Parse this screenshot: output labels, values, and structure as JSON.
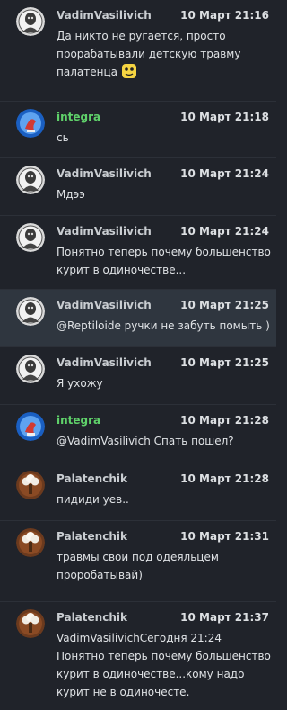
{
  "messages": [
    {
      "author": "VadimVasilivich",
      "avatar": "vadim-avatar",
      "time": "10 Март 21:16",
      "text": "Да никто не ругается, просто прорабатывали детскую травму палатенца",
      "emoji": "emoji-sticker"
    },
    {
      "author": "integra",
      "avatar": "integra-avatar",
      "time": "10 Март 21:18",
      "text": "сь"
    },
    {
      "author": "VadimVasilivich",
      "avatar": "vadim-avatar",
      "time": "10 Март 21:24",
      "text": "Мдээ"
    },
    {
      "author": "VadimVasilivich",
      "avatar": "vadim-avatar",
      "time": "10 Март 21:24",
      "text": "Понятно теперь почему большенство курит в одиночестве..."
    },
    {
      "author": "VadimVasilivich",
      "avatar": "vadim-avatar",
      "time": "10 Март 21:25",
      "text": "@Reptiloide ручки не забуть помыть )"
    },
    {
      "author": "VadimVasilivich",
      "avatar": "vadim-avatar",
      "time": "10 Март 21:25",
      "text": "Я ухожу"
    },
    {
      "author": "integra",
      "avatar": "integra-avatar",
      "time": "10 Март 21:28",
      "text": "@VadimVasilivich Спать пошел?"
    },
    {
      "author": "Palatenchik",
      "avatar": "palatenchik-avatar",
      "time": "10 Март 21:28",
      "text": "пидиди уев.."
    },
    {
      "author": "Palatenchik",
      "avatar": "palatenchik-avatar",
      "time": "10 Март 21:31",
      "text": "травмы свои под одеяльцем проробатывай)"
    },
    {
      "author": "Palatenchik",
      "avatar": "palatenchik-avatar",
      "time": "10 Март 21:37",
      "text": "VadimVasilivichСегодня 21:24 Понятно теперь почему большенство курит в одиночестве...кому надо курит не в одиночесте."
    }
  ]
}
